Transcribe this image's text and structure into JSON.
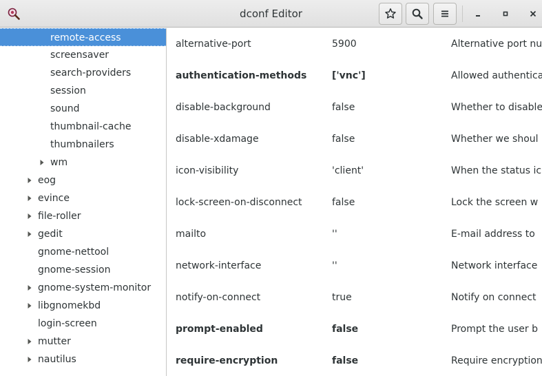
{
  "window": {
    "title": "dconf Editor"
  },
  "header": {
    "icons": {
      "app": "dconf-editor-icon",
      "bookmark": "star-icon",
      "search": "search-icon",
      "menu": "hamburger-menu-icon"
    },
    "window_controls": {
      "minimize": "minimize-icon",
      "maximize": "maximize-icon",
      "close": "close-icon"
    }
  },
  "sidebar": {
    "items": [
      {
        "label": "remote-access",
        "level": 2,
        "expander": false,
        "selected": true
      },
      {
        "label": "screensaver",
        "level": 2,
        "expander": false
      },
      {
        "label": "search-providers",
        "level": 2,
        "expander": false
      },
      {
        "label": "session",
        "level": 2,
        "expander": false
      },
      {
        "label": "sound",
        "level": 2,
        "expander": false
      },
      {
        "label": "thumbnail-cache",
        "level": 2,
        "expander": false
      },
      {
        "label": "thumbnailers",
        "level": 2,
        "expander": false
      },
      {
        "label": "wm",
        "level": 2,
        "expander": true
      },
      {
        "label": "eog",
        "level": 1,
        "expander": true
      },
      {
        "label": "evince",
        "level": 1,
        "expander": true
      },
      {
        "label": "file-roller",
        "level": 1,
        "expander": true
      },
      {
        "label": "gedit",
        "level": 1,
        "expander": true
      },
      {
        "label": "gnome-nettool",
        "level": 1,
        "expander": false
      },
      {
        "label": "gnome-session",
        "level": 1,
        "expander": false
      },
      {
        "label": "gnome-system-monitor",
        "level": 1,
        "expander": true
      },
      {
        "label": "libgnomekbd",
        "level": 1,
        "expander": true
      },
      {
        "label": "login-screen",
        "level": 1,
        "expander": false
      },
      {
        "label": "mutter",
        "level": 1,
        "expander": true
      },
      {
        "label": "nautilus",
        "level": 1,
        "expander": true
      }
    ]
  },
  "keys": [
    {
      "name": "alternative-port",
      "value": "5900",
      "summary": "Alternative port nu",
      "bold": false
    },
    {
      "name": "authentication-methods",
      "value": "['vnc']",
      "summary": "Allowed authentica",
      "bold": true
    },
    {
      "name": "disable-background",
      "value": "false",
      "summary": "Whether to disable",
      "bold": false
    },
    {
      "name": "disable-xdamage",
      "value": "false",
      "summary": "Whether we shoul",
      "bold": false
    },
    {
      "name": "icon-visibility",
      "value": "'client'",
      "summary": "When the status ic",
      "bold": false
    },
    {
      "name": "lock-screen-on-disconnect",
      "value": "false",
      "summary": "Lock the screen w",
      "bold": false
    },
    {
      "name": "mailto",
      "value": "''",
      "summary": "E-mail address to",
      "bold": false
    },
    {
      "name": "network-interface",
      "value": "''",
      "summary": "Network interface",
      "bold": false
    },
    {
      "name": "notify-on-connect",
      "value": "true",
      "summary": "Notify on connect",
      "bold": false
    },
    {
      "name": "prompt-enabled",
      "value": "false",
      "summary": "Prompt the user b",
      "bold": true
    },
    {
      "name": "require-encryption",
      "value": "false",
      "summary": "Require encryption",
      "bold": true
    }
  ],
  "colors": {
    "selection": "#4a90d9",
    "headerbar": "#e8e8e7",
    "text": "#2e3436"
  }
}
